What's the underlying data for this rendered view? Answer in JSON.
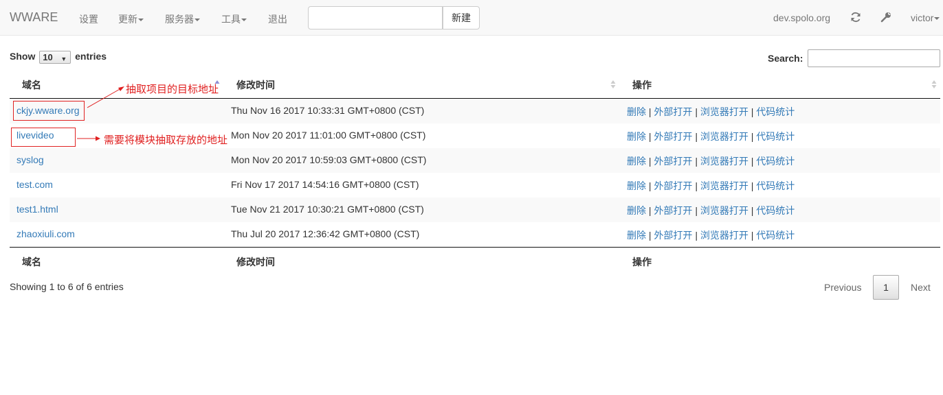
{
  "navbar": {
    "brand": "WWARE",
    "menu": [
      {
        "label": "设置",
        "dropdown": false
      },
      {
        "label": "更新",
        "dropdown": true
      },
      {
        "label": "服务器",
        "dropdown": true
      },
      {
        "label": "工具",
        "dropdown": true
      },
      {
        "label": "退出",
        "dropdown": false
      }
    ],
    "new_input": {
      "value": "",
      "placeholder": ""
    },
    "new_button": "新建",
    "host": "dev.spolo.org",
    "refresh_icon": "refresh-icon",
    "wrench_icon": "wrench-icon",
    "user": "victor"
  },
  "table_controls": {
    "show_label": "Show",
    "page_size": "10",
    "entries_label": "entries",
    "search_label": "Search:",
    "search_value": ""
  },
  "table": {
    "columns": [
      "域名",
      "修改时间",
      "操作"
    ],
    "rows": [
      {
        "domain": "ckjy.wware.org",
        "modified": "Thu Nov 16 2017 10:33:31 GMT+0800 (CST)"
      },
      {
        "domain": "livevideo",
        "modified": "Mon Nov 20 2017 11:01:00 GMT+0800 (CST)"
      },
      {
        "domain": "syslog",
        "modified": "Mon Nov 20 2017 10:59:03 GMT+0800 (CST)"
      },
      {
        "domain": "test.com",
        "modified": "Fri Nov 17 2017 14:54:16 GMT+0800 (CST)"
      },
      {
        "domain": "test1.html",
        "modified": "Tue Nov 21 2017 10:30:21 GMT+0800 (CST)"
      },
      {
        "domain": "zhaoxiuli.com",
        "modified": "Thu Jul 20 2017 12:36:42 GMT+0800 (CST)"
      }
    ],
    "actions": [
      "删除",
      "外部打开",
      "浏览器打开",
      "代码统计"
    ],
    "separator": "|"
  },
  "footer": {
    "info": "Showing 1 to 6 of 6 entries",
    "previous": "Previous",
    "current_page": "1",
    "next": "Next"
  },
  "annotations": {
    "target_address": "抽取项目的目标地址",
    "storage_address": "需要将模块抽取存放的地址",
    "color": "#e02020"
  },
  "colors": {
    "link": "#337ab7",
    "navbar_bg": "#f8f8f8",
    "annotation": "#e02020"
  }
}
